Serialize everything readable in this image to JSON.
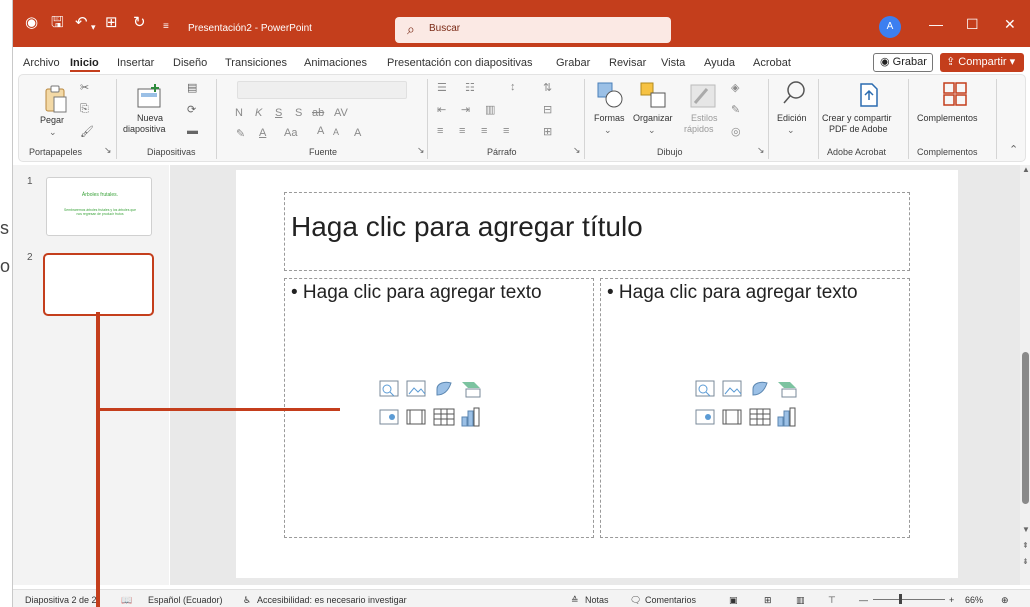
{
  "app": {
    "document_title": "Presentación2 - PowerPoint",
    "search_placeholder": "Buscar",
    "user_initial": "A"
  },
  "background_fragments": [
    "s",
    "o"
  ],
  "menu_tabs": [
    "Archivo",
    "Inicio",
    "Insertar",
    "Diseño",
    "Transiciones",
    "Animaciones",
    "Presentación con diapositivas",
    "Grabar",
    "Revisar",
    "Vista",
    "Ayuda",
    "Acrobat"
  ],
  "active_tab": "Inicio",
  "grabar_button": "Grabar",
  "share_button": "Compartir",
  "ribbon": {
    "groups": {
      "clipboard": "Portapapeles",
      "slides": "Diapositivas",
      "font": "Fuente",
      "paragraph": "Párrafo",
      "drawing": "Dibujo",
      "acrobat": "Adobe Acrobat",
      "addins": "Complementos"
    },
    "buttons": {
      "paste": "Pegar",
      "new_slide_line1": "Nueva",
      "new_slide_line2": "diapositiva",
      "shapes": "Formas",
      "arrange": "Organizar",
      "quick_styles_line1": "Estilos",
      "quick_styles_line2": "rápidos",
      "editing": "Edición",
      "create_pdf_line1": "Crear y compartir",
      "create_pdf_line2": "PDF de Adobe",
      "addins": "Complementos"
    },
    "font_letters": {
      "bold": "N",
      "italic": "K",
      "underline": "S",
      "shadow": "S",
      "strikethrough": "ab",
      "spacing": "AV",
      "case": "Aa",
      "grow": "A",
      "shrink": "A",
      "font_color": "A",
      "clear": "A"
    }
  },
  "slides_pane": {
    "slide1_number": "1",
    "slide1_title": "Árboles frutales.",
    "slide1_body": "Sembraremos árboles frutales y los árboles que nos regresan de producir frutos",
    "slide2_number": "2"
  },
  "slide": {
    "title_placeholder": "Haga clic para agregar título",
    "left_content": "• Haga clic para agregar texto",
    "right_content": "• Haga clic para agregar texto"
  },
  "status": {
    "slide_info": "Diapositiva 2 de 2",
    "language": "Español (Ecuador)",
    "accessibility": "Accesibilidad: es necesario investigar",
    "notes": "Notas",
    "comments": "Comentarios",
    "zoom": "66%"
  },
  "colors": {
    "accent": "#c43e1c",
    "scrollbar": "#8a8a8a"
  }
}
